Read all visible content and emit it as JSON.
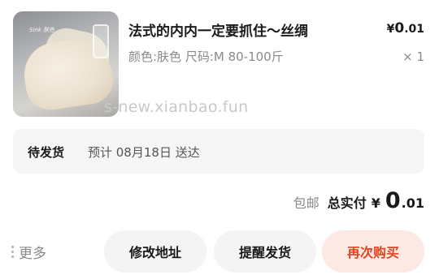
{
  "product": {
    "image_caption": "Sink 肤色",
    "title": "法式的内内一定要抓住～丝绸",
    "spec": "颜色:肤色 尺码:M 80-100斤",
    "price_currency": "¥",
    "price_int": "0",
    "price_dec": ".01",
    "quantity": "× 1"
  },
  "watermark": "s-new.xianbao.fun",
  "status": {
    "label": "待发货",
    "eta": "预计 08月18日 送达"
  },
  "total": {
    "shipping": "包邮",
    "label": "总实付",
    "currency": "¥",
    "int": "0",
    "dec": ".01"
  },
  "actions": {
    "more": "更多",
    "modify_address": "修改地址",
    "remind_ship": "提醒发货",
    "buy_again": "再次购买"
  },
  "colors": {
    "accent": "#e0431f",
    "accent_bg": "#fde9e4"
  }
}
